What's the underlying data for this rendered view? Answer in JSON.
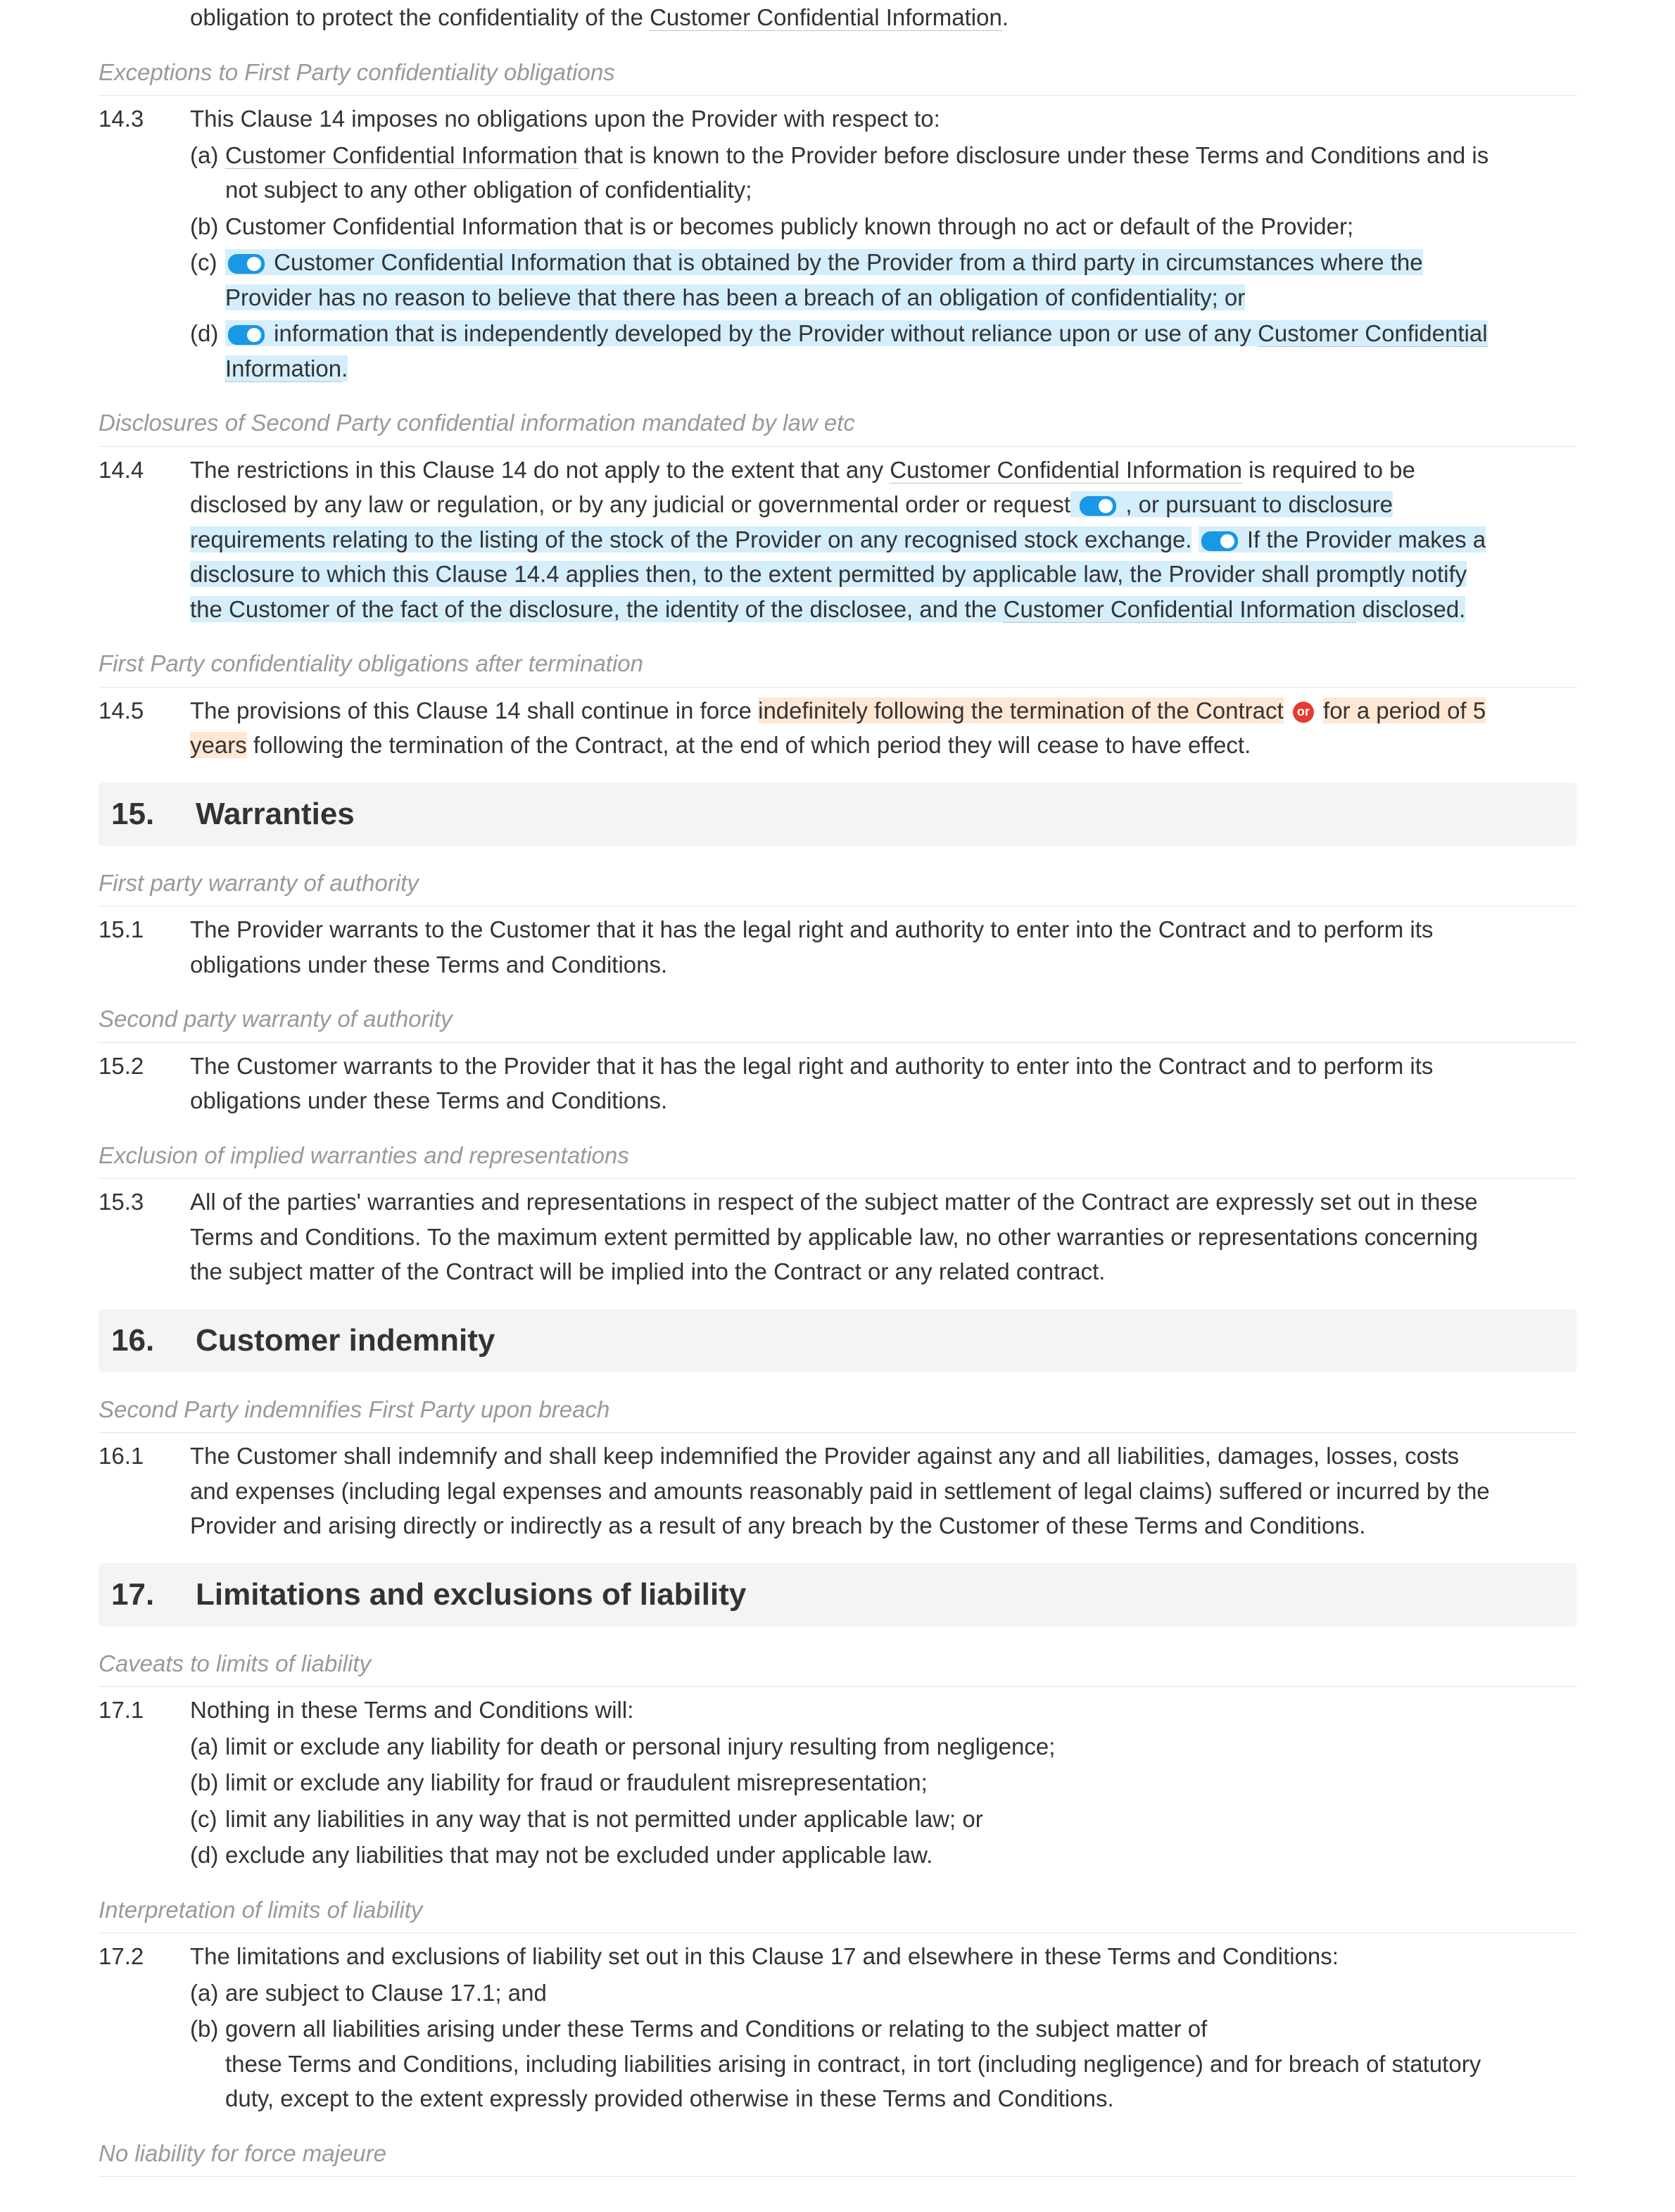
{
  "intro_line": "obligation to protect the confidentiality of the ",
  "intro_term": "Customer Confidential Information",
  "intro_end": ".",
  "ann_14_exceptions": "Exceptions to First Party confidentiality obligations",
  "c14_3": {
    "num": "14.3",
    "intro": "This Clause 14 imposes no obligations upon the Provider with respect to:",
    "a_letter": "(a)",
    "a_term": "Customer Confidential Information",
    "a_rest": " that is known to the Provider before disclosure under these Terms and Conditions and is not subject to any other obligation of confidentiality;",
    "b_letter": "(b)",
    "b_text": "Customer Confidential Information that is or becomes publicly known through no act or default of the Provider;",
    "c_letter": "(c)",
    "c_text": "Customer Confidential Information that is obtained by the Provider from a third party in circumstances where the Provider has no reason to believe that there has been a breach of an obligation of confidentiality; or",
    "d_letter": "(d)",
    "d_pre": "information that is independently developed by the Provider without reliance upon or use of any ",
    "d_term": "Customer Confidential Information",
    "d_end": "."
  },
  "ann_14_disclosures": "Disclosures of Second Party confidential information mandated by law etc",
  "c14_4": {
    "num": "14.4",
    "p1a": "The restrictions in this Clause 14 do not apply to the extent that any ",
    "p1_term": "Customer Confidential Information",
    "p1b": " is required to be disclosed by any law or regulation, or by any judicial or governmental order or request",
    "p2": ", or pursuant to disclosure requirements relating to the listing of the stock of the Provider on any recognised stock exchange.",
    "p3a": "If the Provider makes a disclosure to which this Clause 14.4 applies then, to the extent permitted by applicable law, the Provider shall promptly notify the Customer of the fact of the disclosure, the identity of the disclosee, and the ",
    "p3_term": "Customer Confidential Information",
    "p3b": " disclosed."
  },
  "ann_14_after": "First Party confidentiality obligations after termination",
  "c14_5": {
    "num": "14.5",
    "lead": "The provisions of this Clause 14 shall continue in force ",
    "opt1": "indefinitely following the termination of the Contract",
    "or": "or",
    "opt2a": "for a period of 5 years",
    "opt2b": " following the termination of the Contract, at the end of which period they will cease to have effect."
  },
  "s15": {
    "num": "15.",
    "title": "Warranties"
  },
  "ann_15_1": "First party warranty of authority",
  "c15_1": {
    "num": "15.1",
    "text": "The Provider warrants to the Customer that it has the legal right and authority to enter into the Contract and to perform its obligations under these Terms and Conditions."
  },
  "ann_15_2": "Second party warranty of authority",
  "c15_2": {
    "num": "15.2",
    "text": "The Customer warrants to the Provider that it has the legal right and authority to enter into the Contract and to perform its obligations under these Terms and Conditions."
  },
  "ann_15_3": "Exclusion of implied warranties and representations",
  "c15_3": {
    "num": "15.3",
    "text": "All of the parties' warranties and representations in respect of the subject matter of the Contract are expressly set out in these Terms and Conditions. To the maximum extent permitted by applicable law, no other warranties or representations concerning the subject matter of the Contract will be implied into the Contract or any related contract."
  },
  "s16": {
    "num": "16.",
    "title": "Customer indemnity"
  },
  "ann_16_1": "Second Party indemnifies First Party upon breach",
  "c16_1": {
    "num": "16.1",
    "text": "The Customer shall indemnify and shall keep indemnified the Provider against any and all liabilities, damages, losses, costs and expenses (including legal expenses and amounts reasonably paid in settlement of legal claims) suffered or incurred by the Provider and arising directly or indirectly as a result of any breach by the Customer of these Terms and Conditions."
  },
  "s17": {
    "num": "17.",
    "title": "Limitations and exclusions of liability"
  },
  "ann_17_1": "Caveats to limits of liability",
  "c17_1": {
    "num": "17.1",
    "intro": "Nothing in these Terms and Conditions will:",
    "a_letter": "(a)",
    "a": "limit or exclude any liability for death or personal injury resulting from negligence;",
    "b_letter": "(b)",
    "b": "limit or exclude any liability for fraud or fraudulent misrepresentation;",
    "c_letter": "(c)",
    "c": "limit any liabilities in any way that is not permitted under applicable law; or",
    "d_letter": "(d)",
    "d": "exclude any liabilities that may not be excluded under applicable law."
  },
  "ann_17_2": "Interpretation of limits of liability",
  "c17_2": {
    "num": "17.2",
    "intro": "The limitations and exclusions of liability set out in this Clause 17 and elsewhere in these Terms and Conditions:",
    "a_letter": "(a)",
    "a": "are subject to Clause 17.1; and",
    "b_letter": "(b)",
    "b1": "govern all liabilities arising under these Terms and Conditions or relating to the subject matter of",
    "b2": "these Terms and Conditions, including liabilities arising in contract, in tort (including negligence) and for breach of statutory duty, except to the extent expressly provided otherwise in these Terms and Conditions."
  },
  "ann_17_3": "No liability for force majeure"
}
